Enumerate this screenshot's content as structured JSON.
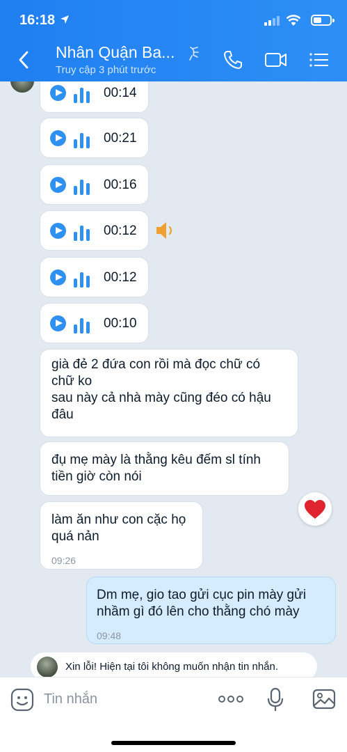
{
  "status_bar": {
    "time": "16:18"
  },
  "header": {
    "contact_name": "Nhân Quận Ba...",
    "presence": "Truy cập 3 phút trước"
  },
  "voice_messages": [
    {
      "duration": "00:14"
    },
    {
      "duration": "00:21"
    },
    {
      "duration": "00:16"
    },
    {
      "duration": "00:12"
    },
    {
      "duration": "00:12"
    },
    {
      "duration": "00:10"
    }
  ],
  "text_messages": [
    {
      "line1": "già đẻ 2 đứa con rồi mà đọc chữ có",
      "line2": "chữ ko",
      "line3": "sau này cả nhà mày cũng đéo có hậu",
      "line4": "đâu"
    },
    {
      "line1": "đụ mẹ mày là thằng kêu đếm sl tính",
      "line2": "tiền giờ còn nói"
    },
    {
      "line1": "làm ăn như con cặc họ",
      "line2": "quá nản",
      "time": "09:26"
    }
  ],
  "my_message": {
    "line1": "Dm mẹ, gio tao gửi cục pin mày gửi",
    "line2": "nhầm gì đó lên cho thằng chó mày",
    "time": "09:48"
  },
  "notice": {
    "text": "Xin lỗi! Hiện tại tôi không muốn nhận tin nhắn."
  },
  "input": {
    "placeholder": "Tin nhắn"
  },
  "icons": {
    "back": "chevron-left-icon",
    "call": "phone-icon",
    "video": "video-camera-icon",
    "menu": "list-menu-icon",
    "emoji": "emoji-icon",
    "more": "more-dots-icon",
    "mic": "microphone-icon",
    "image": "image-icon",
    "reaction": "heart-icon",
    "playing": "speaker-icon"
  },
  "colors": {
    "header": "#1f7ff1",
    "accent": "#2e90f0",
    "my_bubble": "#d5ecff",
    "chat_bg": "#e2e9f1",
    "heart": "#e0242f",
    "speaker": "#f0a02e"
  }
}
